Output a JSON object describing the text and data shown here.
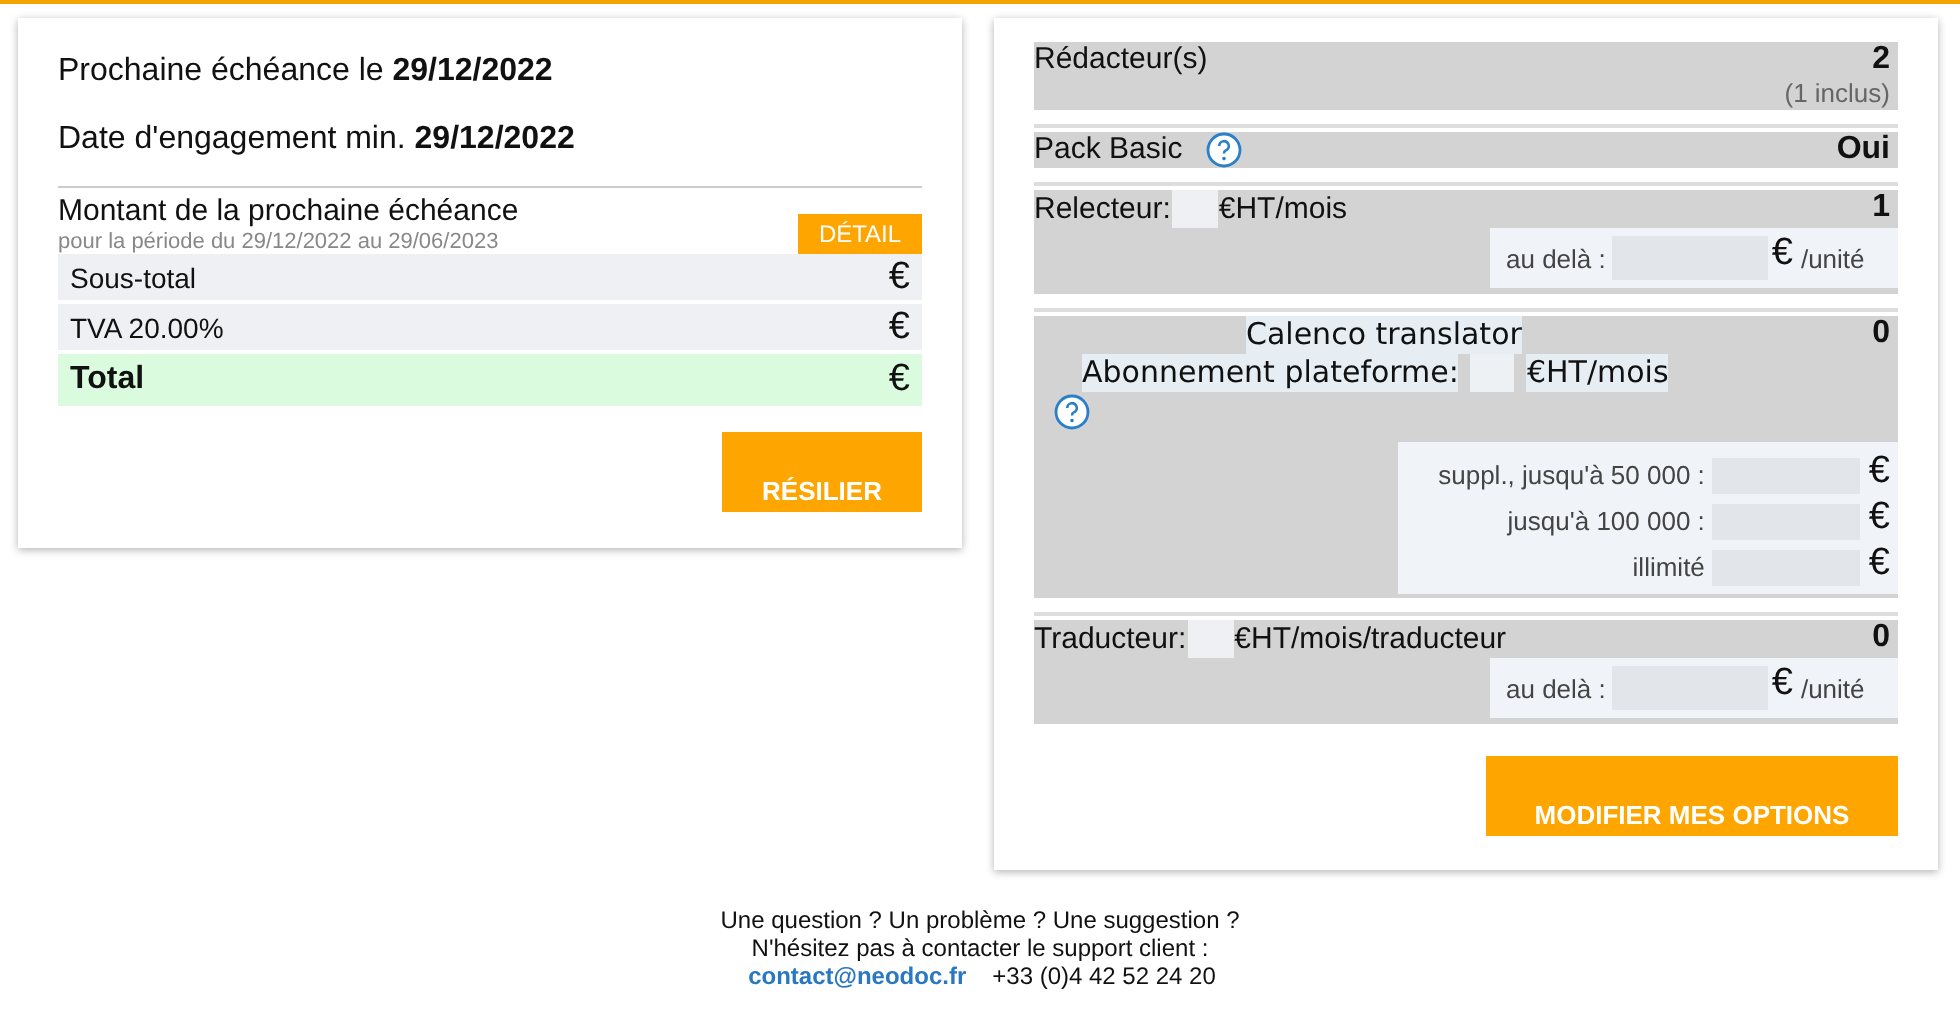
{
  "schedule": {
    "lines": [
      {
        "label": "Prochaine échéance le",
        "value": "29/12/2022"
      },
      {
        "label": "Date d'engagement min.",
        "value": "29/12/2022"
      }
    ],
    "amount": {
      "title": "Montant de la prochaine échéance",
      "period": "pour la période du 29/12/2022 au 29/06/2023",
      "detail_button": "DÉTAIL",
      "rows": [
        {
          "kind": "line",
          "label": "Sous-total",
          "value": "€"
        },
        {
          "kind": "line",
          "label": "TVA 20.00%",
          "value": "€"
        },
        {
          "kind": "total",
          "label": "Total",
          "value": "€"
        }
      ]
    },
    "button": "RÉSILIER"
  },
  "options": {
    "items": [
      {
        "kind": "count",
        "label": "Rédacteur(s)",
        "count": "2",
        "note": "(1 inclus)"
      },
      {
        "kind": "help",
        "label": "Pack Basic",
        "count": "Oui"
      },
      {
        "kind": "priced",
        "label": "Relecteur:",
        "unit": "€HT/mois",
        "count": "1",
        "beyond": {
          "label": "au delà :",
          "currency": "€",
          "unit": "/unité"
        }
      },
      {
        "kind": "platform",
        "title": "Calenco translator",
        "label": "Abonnement plateforme:",
        "unit": "€HT/mois",
        "count": "0",
        "tiers": [
          {
            "label": "suppl., jusqu'à 50 000 :",
            "currency": "€"
          },
          {
            "label": "jusqu'à 100 000 :",
            "currency": "€"
          },
          {
            "label": "illimité",
            "currency": "€"
          }
        ]
      },
      {
        "kind": "priced",
        "label": "Traducteur:",
        "unit": "€HT/mois/traducteur",
        "count": "0",
        "beyond": {
          "label": "au delà :",
          "currency": "€",
          "unit": "/unité"
        }
      }
    ],
    "button": "MODIFIER MES OPTIONS"
  },
  "footer": {
    "lines": [
      "Une question ? Un problème ? Une suggestion ?",
      "N'hésitez pas à contacter le support client :"
    ],
    "email": "contact@neodoc.fr",
    "phone": "+33 (0)4 42 52 24 20"
  }
}
